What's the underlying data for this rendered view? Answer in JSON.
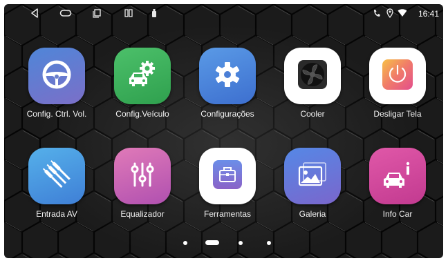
{
  "status": {
    "time": "16:41"
  },
  "apps": [
    {
      "label": "Config. Ctrl. Vol.",
      "icon": "steering-wheel-icon",
      "color": "#6a7fcb"
    },
    {
      "label": "Config.Veículo",
      "icon": "car-gear-icon",
      "color": "#3fb15c"
    },
    {
      "label": "Configurações",
      "icon": "gear-icon",
      "color": "#4b7fd6"
    },
    {
      "label": "Cooler",
      "icon": "fan-icon",
      "color": "#ffffff"
    },
    {
      "label": "Desligar Tela",
      "icon": "power-icon",
      "color": "#ffffff"
    },
    {
      "label": "Entrada AV",
      "icon": "av-cable-icon",
      "color": "#4a9ae0"
    },
    {
      "label": "Equalizador",
      "icon": "equalizer-icon",
      "color": "#d266b4"
    },
    {
      "label": "Ferramentas",
      "icon": "toolbox-icon",
      "color": "#ffffff"
    },
    {
      "label": "Galeria",
      "icon": "gallery-icon",
      "color": "#5a7ee0"
    },
    {
      "label": "Info Car",
      "icon": "car-info-icon",
      "color": "#d0479c"
    }
  ],
  "pager": {
    "page_count": 4,
    "current_page": 2
  }
}
